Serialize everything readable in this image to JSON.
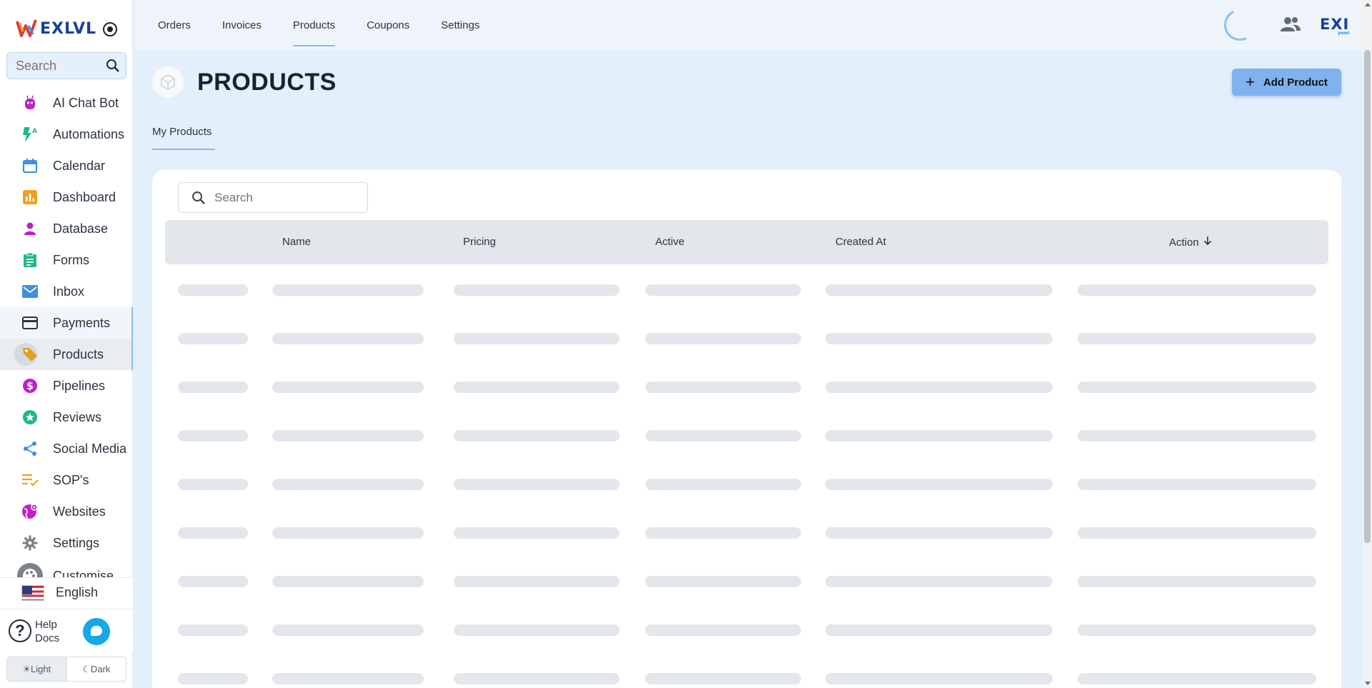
{
  "app": {
    "logo_text": "EXLVL",
    "language": "English"
  },
  "sidebar": {
    "search_placeholder": "Search",
    "items": [
      {
        "label": "AI Chat Bot",
        "icon": "robot-icon",
        "color": "#c020c8"
      },
      {
        "label": "Automations",
        "icon": "lightning-icon",
        "color": "#1bb98a"
      },
      {
        "label": "Calendar",
        "icon": "calendar-icon",
        "color": "#3d8fe0"
      },
      {
        "label": "Dashboard",
        "icon": "bar-chart-icon",
        "color": "#f0a11e"
      },
      {
        "label": "Database",
        "icon": "person-icon",
        "color": "#c020c8"
      },
      {
        "label": "Forms",
        "icon": "clipboard-icon",
        "color": "#1bb98a"
      },
      {
        "label": "Inbox",
        "icon": "mail-icon",
        "color": "#3d8fe0"
      },
      {
        "label": "Payments",
        "icon": "credit-card-icon",
        "color": "#333333"
      },
      {
        "label": "Products",
        "icon": "tag-icon",
        "color": "#e3a028"
      },
      {
        "label": "Pipelines",
        "icon": "dollar-icon",
        "color": "#c020c8"
      },
      {
        "label": "Reviews",
        "icon": "star-icon",
        "color": "#1bb98a"
      },
      {
        "label": "Social Media",
        "icon": "share-icon",
        "color": "#3d8fe0"
      },
      {
        "label": "SOP's",
        "icon": "checklist-icon",
        "color": "#f0a11e"
      },
      {
        "label": "Websites",
        "icon": "globe-icon",
        "color": "#c020c8"
      },
      {
        "label": "Settings",
        "icon": "gear-icon",
        "color": "#7a7f86"
      },
      {
        "label": "Customise",
        "icon": "palette-icon",
        "color": "#7a7f86"
      }
    ],
    "help": {
      "line1": "Help",
      "line2": "Docs"
    },
    "theme": {
      "light": "☀Light",
      "dark": "☾Dark"
    }
  },
  "topnav": {
    "tabs": [
      "Orders",
      "Invoices",
      "Products",
      "Coupons",
      "Settings"
    ],
    "active": "Products",
    "brand": "EXI",
    "brand_sub": "powi"
  },
  "page": {
    "title": "PRODUCTS",
    "add_button": "Add Product",
    "subtab": "My Products"
  },
  "table": {
    "search_placeholder": "Search",
    "columns": [
      "",
      "Name",
      "Pricing",
      "Active",
      "Created At",
      "Action"
    ],
    "sort_column": "Action",
    "loading_rows": 9
  },
  "colors": {
    "accent": "#7fb2ee",
    "page_bg": "#e3effb",
    "skeleton": "#e3e6ea"
  }
}
